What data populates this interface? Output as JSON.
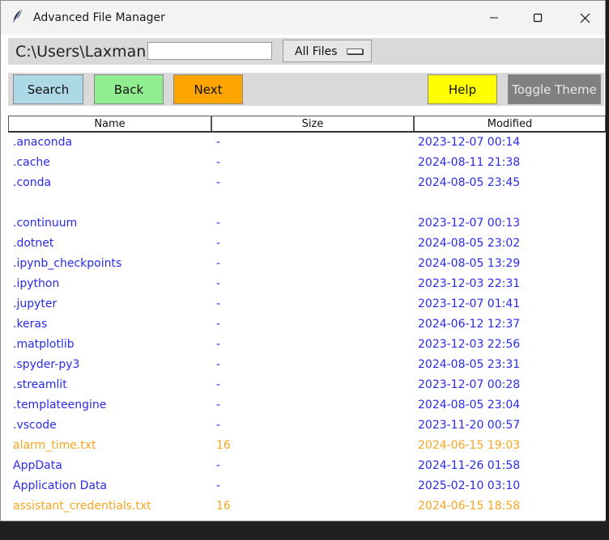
{
  "window": {
    "title": "Advanced File Manager"
  },
  "path_bar": {
    "path": "C:\\Users\\Laxman",
    "search_value": "",
    "filter_selected": "All Files"
  },
  "buttons": {
    "search": "Search",
    "back": "Back",
    "next": "Next",
    "help": "Help",
    "toggle_theme": "Toggle Theme"
  },
  "colors": {
    "directory": "#2a2aea",
    "file": "#f5a623",
    "search_btn": "#add8e6",
    "back_btn": "#90ee90",
    "next_btn": "#ffa500",
    "help_btn": "#ffff00",
    "toggle_btn": "#808080"
  },
  "table": {
    "headers": {
      "name": "Name",
      "size": "Size",
      "modified": "Modified"
    },
    "rows": [
      {
        "name": ".anaconda",
        "size": "-",
        "modified": "2023-12-07 00:14",
        "kind": "dir"
      },
      {
        "name": ".cache",
        "size": "-",
        "modified": "2024-08-11 21:38",
        "kind": "dir"
      },
      {
        "name": ".conda",
        "size": "-",
        "modified": "2024-08-05 23:45",
        "kind": "dir"
      },
      {
        "name": "",
        "size": "",
        "modified": "",
        "kind": "dir"
      },
      {
        "name": ".continuum",
        "size": "-",
        "modified": "2023-12-07 00:13",
        "kind": "dir"
      },
      {
        "name": ".dotnet",
        "size": "-",
        "modified": "2024-08-05 23:02",
        "kind": "dir"
      },
      {
        "name": ".ipynb_checkpoints",
        "size": "-",
        "modified": "2024-08-05 13:29",
        "kind": "dir"
      },
      {
        "name": ".ipython",
        "size": "-",
        "modified": "2023-12-03 22:31",
        "kind": "dir"
      },
      {
        "name": ".jupyter",
        "size": "-",
        "modified": "2023-12-07 01:41",
        "kind": "dir"
      },
      {
        "name": ".keras",
        "size": "-",
        "modified": "2024-06-12 12:37",
        "kind": "dir"
      },
      {
        "name": ".matplotlib",
        "size": "-",
        "modified": "2023-12-03 22:56",
        "kind": "dir"
      },
      {
        "name": ".spyder-py3",
        "size": "-",
        "modified": "2024-08-05 23:31",
        "kind": "dir"
      },
      {
        "name": ".streamlit",
        "size": "-",
        "modified": "2023-12-07 00:28",
        "kind": "dir"
      },
      {
        "name": ".templateengine",
        "size": "-",
        "modified": "2024-08-05 23:04",
        "kind": "dir"
      },
      {
        "name": ".vscode",
        "size": "-",
        "modified": "2023-11-20 00:57",
        "kind": "dir"
      },
      {
        "name": "alarm_time.txt",
        "size": "16",
        "modified": "2024-06-15 19:03",
        "kind": "file"
      },
      {
        "name": "AppData",
        "size": "-",
        "modified": "2024-11-26 01:58",
        "kind": "dir"
      },
      {
        "name": "Application Data",
        "size": "-",
        "modified": "2025-02-10 03:10",
        "kind": "dir"
      },
      {
        "name": "assistant_credentials.txt",
        "size": "16",
        "modified": "2024-06-15 18:58",
        "kind": "file"
      }
    ]
  },
  "icons": {
    "app": "feather-icon",
    "minimize": "minimize-icon",
    "maximize": "maximize-icon",
    "close": "close-icon"
  }
}
